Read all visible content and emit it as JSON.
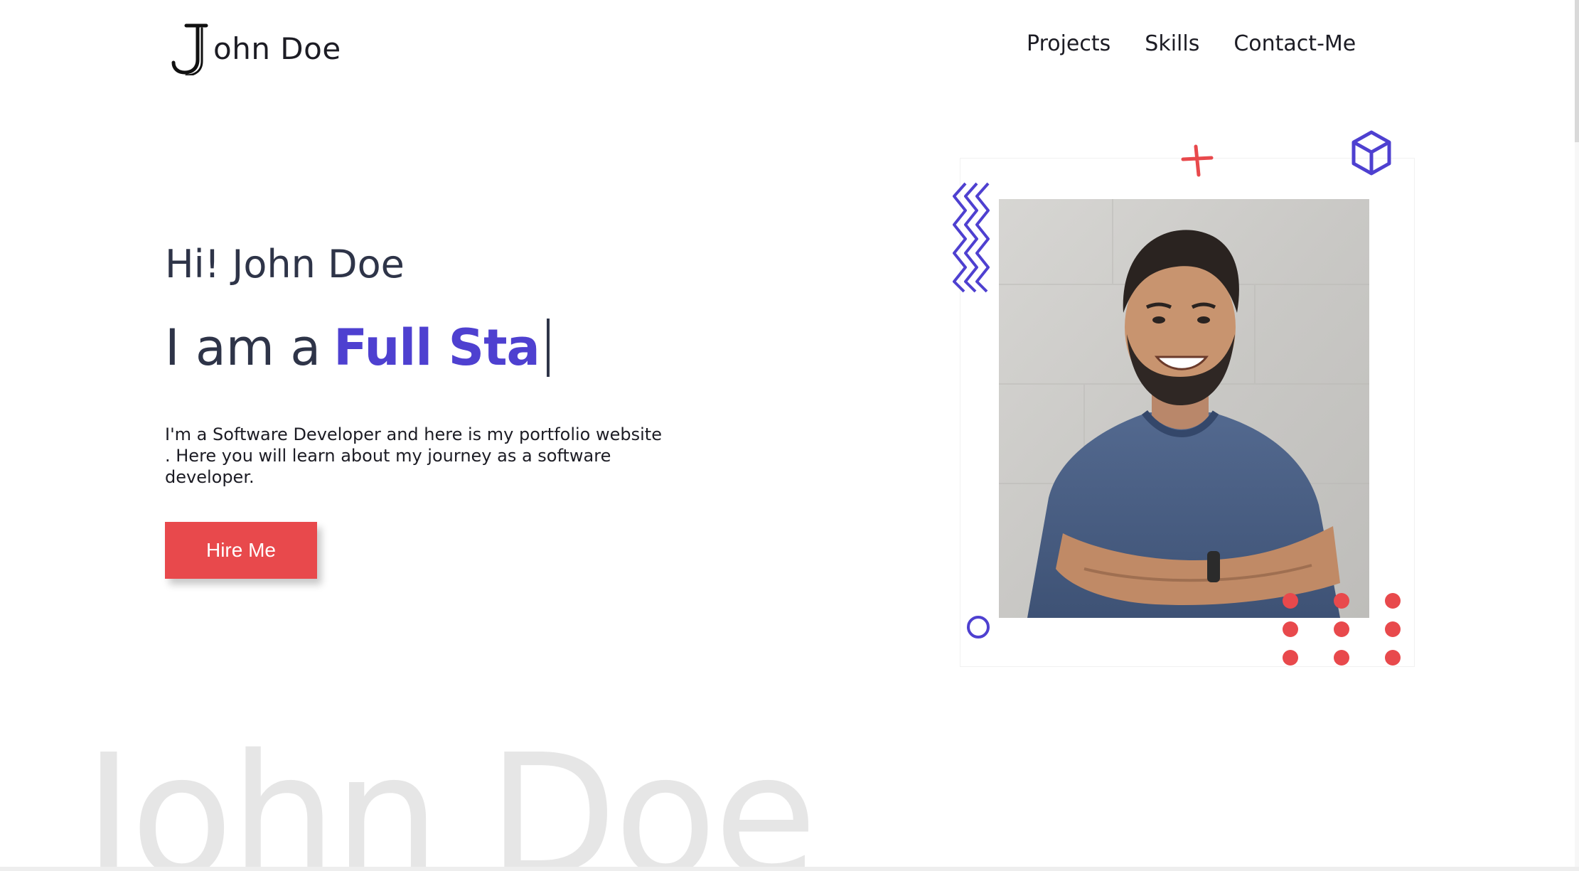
{
  "header": {
    "logo_initial": "J",
    "logo_rest": "ohn Doe",
    "nav": [
      {
        "label": "Projects"
      },
      {
        "label": "Skills"
      },
      {
        "label": "Contact-Me"
      }
    ]
  },
  "hero": {
    "greeting": "Hi! John Doe",
    "role_prefix": "I am a",
    "role_typed": "Full Sta",
    "bio": "I'm a Software Developer and here is my portfolio website . Here you will learn about my journey as a software developer.",
    "cta_label": "Hire Me"
  },
  "background_text": "John Doe",
  "colors": {
    "accent": "#4e40d0",
    "cta": "#e8494c",
    "text": "#2e3448"
  },
  "icons": {
    "decorations": [
      "plus-icon",
      "cube-icon",
      "zigzag-icon",
      "circle-icon",
      "dot-grid-icon"
    ]
  }
}
